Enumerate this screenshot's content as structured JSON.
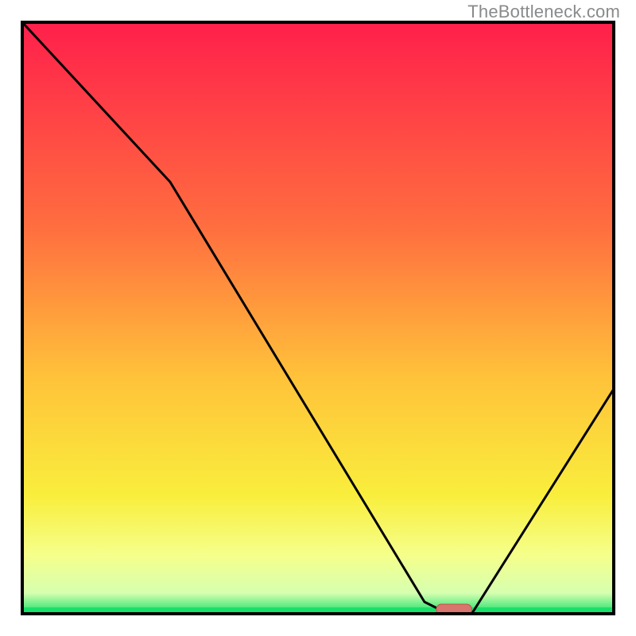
{
  "watermark": "TheBottleneck.com",
  "chart_data": {
    "type": "line",
    "title": "",
    "xlabel": "",
    "ylabel": "",
    "xlim": [
      0,
      100
    ],
    "ylim": [
      0,
      100
    ],
    "x": [
      0,
      25,
      68,
      72,
      76,
      100
    ],
    "values": [
      100,
      73,
      2,
      0,
      0,
      38
    ],
    "optimal_marker": {
      "x": 73,
      "width": 6
    },
    "gradient_stops": [
      {
        "offset": 0.0,
        "color": "#ff1f4b"
      },
      {
        "offset": 0.35,
        "color": "#ff6f3f"
      },
      {
        "offset": 0.6,
        "color": "#ffc23a"
      },
      {
        "offset": 0.8,
        "color": "#f9ee3c"
      },
      {
        "offset": 0.9,
        "color": "#f5ff8a"
      },
      {
        "offset": 0.965,
        "color": "#d7ffb0"
      },
      {
        "offset": 1.0,
        "color": "#18e06a"
      }
    ],
    "bottom_band_color": "#18e06a",
    "marker_fill": "#d9756e",
    "marker_stroke": "#c25248"
  }
}
